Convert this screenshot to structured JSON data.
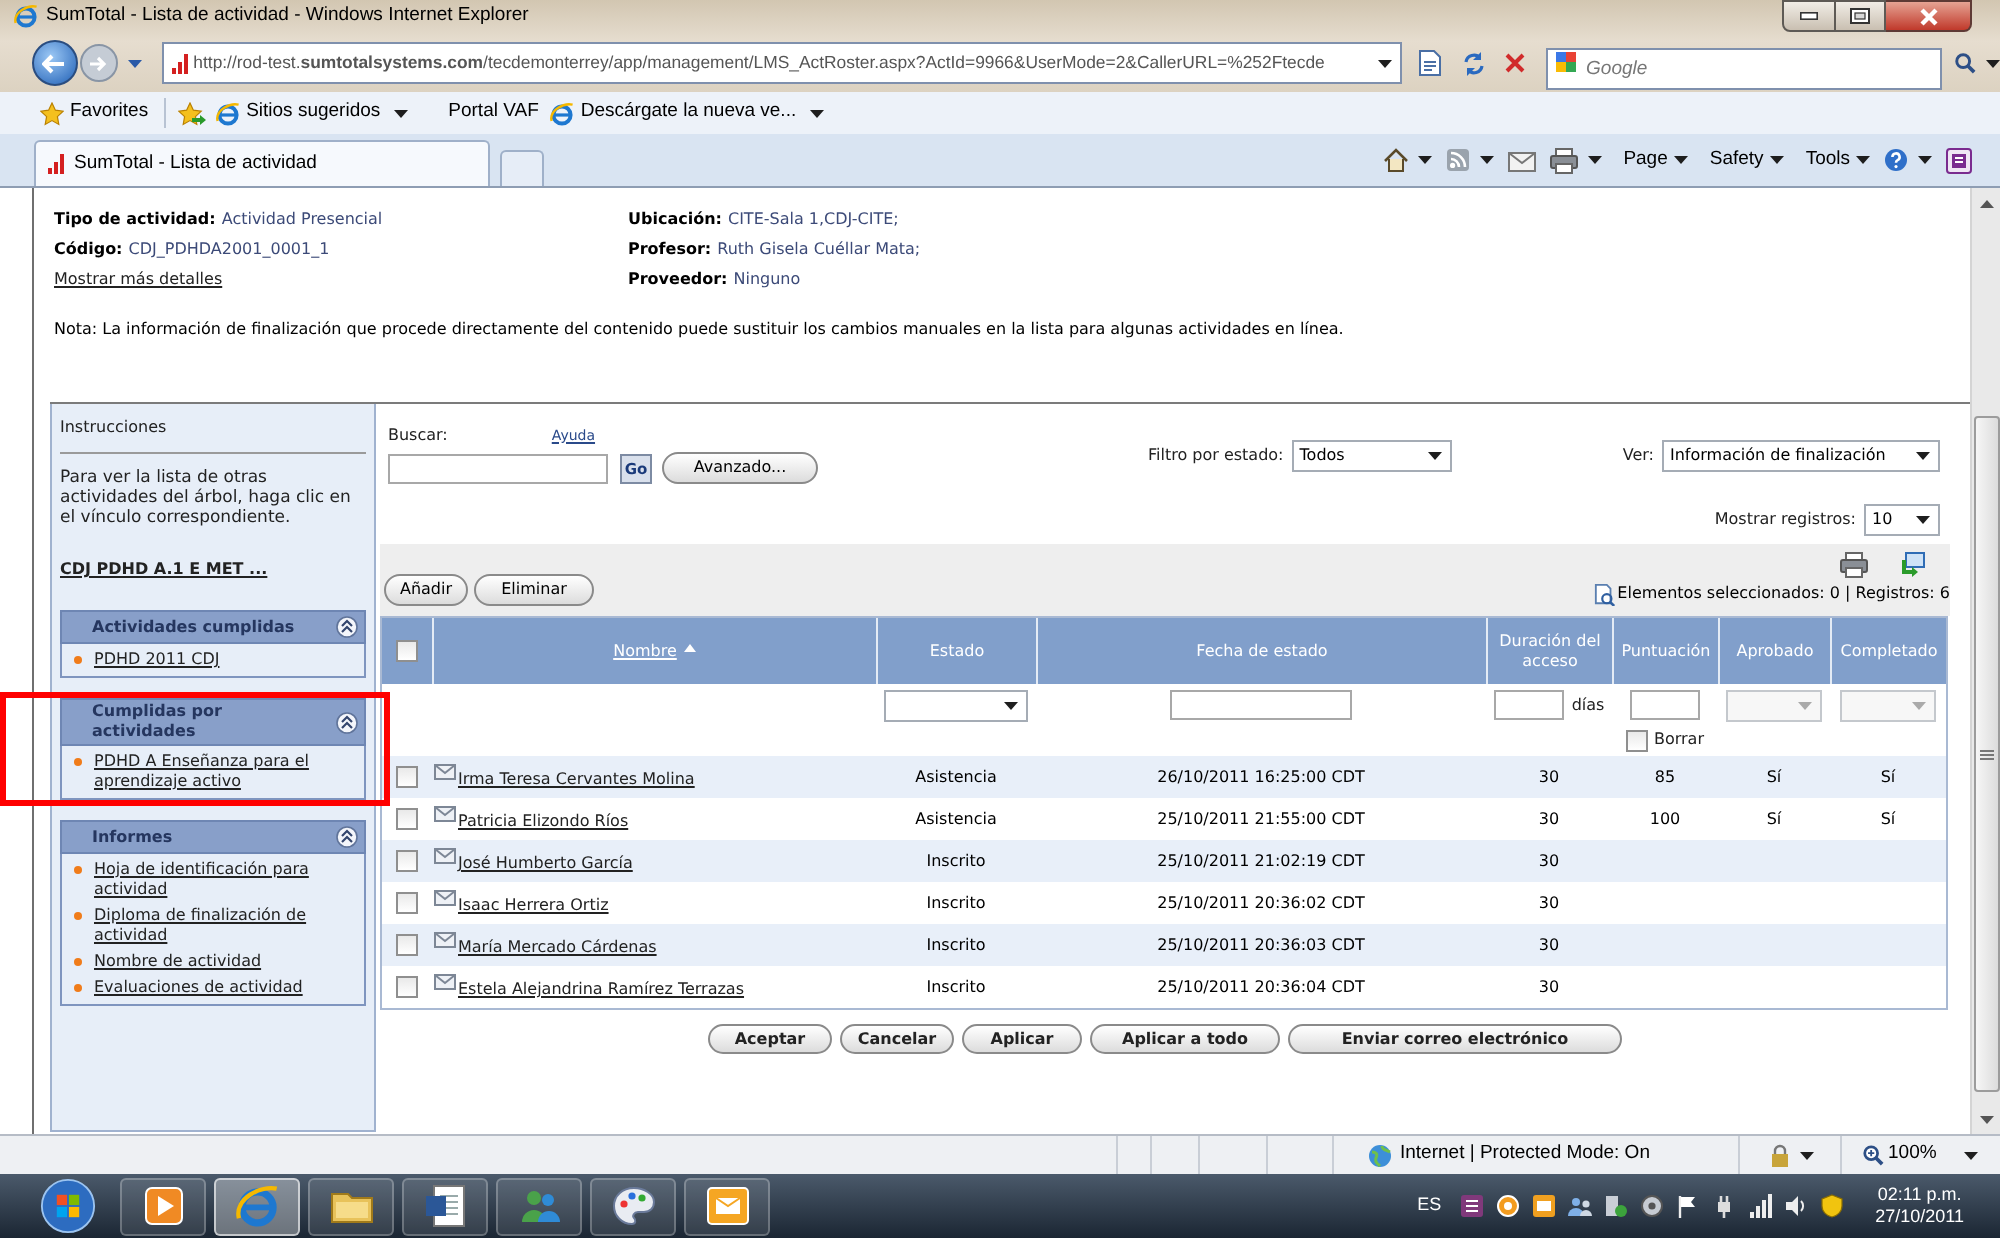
{
  "window": {
    "title": "SumTotal - Lista de actividad - Windows Internet Explorer"
  },
  "address_bar": {
    "url": "http://rod-test.**sumtotalsystems.com**/tecdemonterrey/app/management/LMS_ActRoster.aspx?ActId=9966&UserMode=2&CallerURL=%252Ftecde"
  },
  "search_box": {
    "placeholder": "Google"
  },
  "favorites_bar": {
    "favorites": "Favorites",
    "links": [
      {
        "label": "Sitios sugeridos",
        "kind": "page",
        "dropdown": true
      },
      {
        "label": "Portal VAF",
        "kind": "plain",
        "dropdown": false
      },
      {
        "label": "Descárgate la nueva ve...",
        "kind": "page",
        "dropdown": true
      }
    ]
  },
  "tabs": [
    {
      "label": "SumTotal - Lista de actividad",
      "selected": true
    }
  ],
  "command_bar": [
    {
      "label": "Page"
    },
    {
      "label": "Safety"
    },
    {
      "label": "Tools"
    }
  ],
  "activity": {
    "details": [
      [
        {
          "label": "Tipo de actividad:",
          "value": "Actividad Presencial"
        },
        {
          "label": "Código:",
          "value": "CDJ_PDHDA2001_0001_1"
        }
      ],
      [
        {
          "label": "Ubicación:",
          "value": "CITE-Sala 1,CDJ-CITE;"
        },
        {
          "label": "Profesor:",
          "value": "Ruth Gisela Cuéllar Mata;"
        },
        {
          "label": "Proveedor:",
          "value": "Ninguno"
        }
      ]
    ],
    "more_link": "Mostrar más detalles",
    "note": "Nota: La información de finalización que procede directamente del contenido puede sustituir los cambios manuales en la lista para algunas actividades en línea."
  },
  "sidebar": {
    "title": "Instrucciones",
    "text": "Para ver la lista de otras actividades del árbol, haga clic en el vínculo correspondiente.",
    "tree_link": "CDJ PDHD A.1 E MET ...",
    "sections": [
      {
        "title": "Actividades cumplidas",
        "expanded": true,
        "highlighted": false,
        "links": [
          "PDHD 2011 CDJ"
        ]
      },
      {
        "title": "Cumplidas por actividades",
        "expanded": true,
        "highlighted": true,
        "links": [
          "PDHD A Enseñanza para el aprendizaje activo"
        ]
      },
      {
        "title": "Informes",
        "expanded": true,
        "highlighted": false,
        "links": [
          "Hoja de identificación para actividad",
          "Diploma de finalización de actividad",
          "Nombre de actividad",
          "Evaluaciones de actividad"
        ]
      }
    ]
  },
  "search": {
    "label": "Buscar:",
    "help": "Ayuda",
    "go": "Go",
    "advanced": "Avanzado..."
  },
  "filters": [
    {
      "label": "Filtro por estado:",
      "value": "Todos"
    },
    {
      "label": "Ver:",
      "value": "Información de finalización"
    }
  ],
  "records": {
    "label": "Mostrar registros:",
    "value": "10"
  },
  "toolbar": {
    "buttons": [
      "Añadir",
      "Eliminar"
    ],
    "summary": "Elementos seleccionados: 0 | Registros: 6"
  },
  "table": {
    "select_all": {
      "checked": false
    },
    "columns": [
      {
        "label": "Nombre",
        "sorted": true
      },
      {
        "label": "Estado",
        "sorted": false
      },
      {
        "label": "Fecha de estado",
        "sorted": false
      },
      {
        "label": "Duración del acceso",
        "sorted": false
      },
      {
        "label": "Puntuación",
        "sorted": false
      },
      {
        "label": "Aprobado",
        "sorted": false
      },
      {
        "label": "Completado",
        "sorted": false
      }
    ],
    "filter_row": [
      {
        "kind": "blank"
      },
      {
        "kind": "select",
        "disabled": false
      },
      {
        "kind": "input"
      },
      {
        "kind": "input",
        "unit": "días"
      },
      {
        "kind": "input",
        "clear": {
          "label": "Borrar",
          "checked": false
        }
      },
      {
        "kind": "select",
        "disabled": true
      },
      {
        "kind": "select",
        "disabled": true
      }
    ],
    "rows": [
      {
        "checked": false,
        "name": "Irma Teresa Cervantes Molina",
        "status": "Asistencia",
        "date": "26/10/2011 16:25:00 CDT",
        "duration": "30",
        "score": "85",
        "approved": "Sí",
        "completed": "Sí"
      },
      {
        "checked": false,
        "name": "Patricia Elizondo Ríos",
        "status": "Asistencia",
        "date": "25/10/2011 21:55:00 CDT",
        "duration": "30",
        "score": "100",
        "approved": "Sí",
        "completed": "Sí"
      },
      {
        "checked": false,
        "name": "José Humberto García",
        "status": "Inscrito",
        "date": "25/10/2011 21:02:19 CDT",
        "duration": "30"
      },
      {
        "checked": false,
        "name": "Isaac Herrera Ortiz",
        "status": "Inscrito",
        "date": "25/10/2011 20:36:02 CDT",
        "duration": "30"
      },
      {
        "checked": false,
        "name": "María Mercado Cárdenas",
        "status": "Inscrito",
        "date": "25/10/2011 20:36:03 CDT",
        "duration": "30"
      },
      {
        "checked": false,
        "name": "Estela Alejandrina Ramírez Terrazas",
        "status": "Inscrito",
        "date": "25/10/2011 20:36:04 CDT",
        "duration": "30"
      }
    ]
  },
  "footer_buttons": [
    "Aceptar",
    "Cancelar",
    "Aplicar",
    "Aplicar a todo",
    "Enviar correo electrónico"
  ],
  "status_bar": {
    "zone": "Internet | Protected Mode: On",
    "zoom": "100%"
  },
  "taskbar": {
    "apps": [
      {
        "kind": "media",
        "selected": false
      },
      {
        "kind": "browser",
        "selected": true
      },
      {
        "kind": "folder",
        "selected": false
      },
      {
        "kind": "word",
        "selected": false
      },
      {
        "kind": "messenger",
        "selected": false
      },
      {
        "kind": "paint",
        "selected": false
      },
      {
        "kind": "outlook",
        "selected": false
      }
    ],
    "language": "ES",
    "time": "02:11 p.m.",
    "date": "27/10/2011"
  }
}
